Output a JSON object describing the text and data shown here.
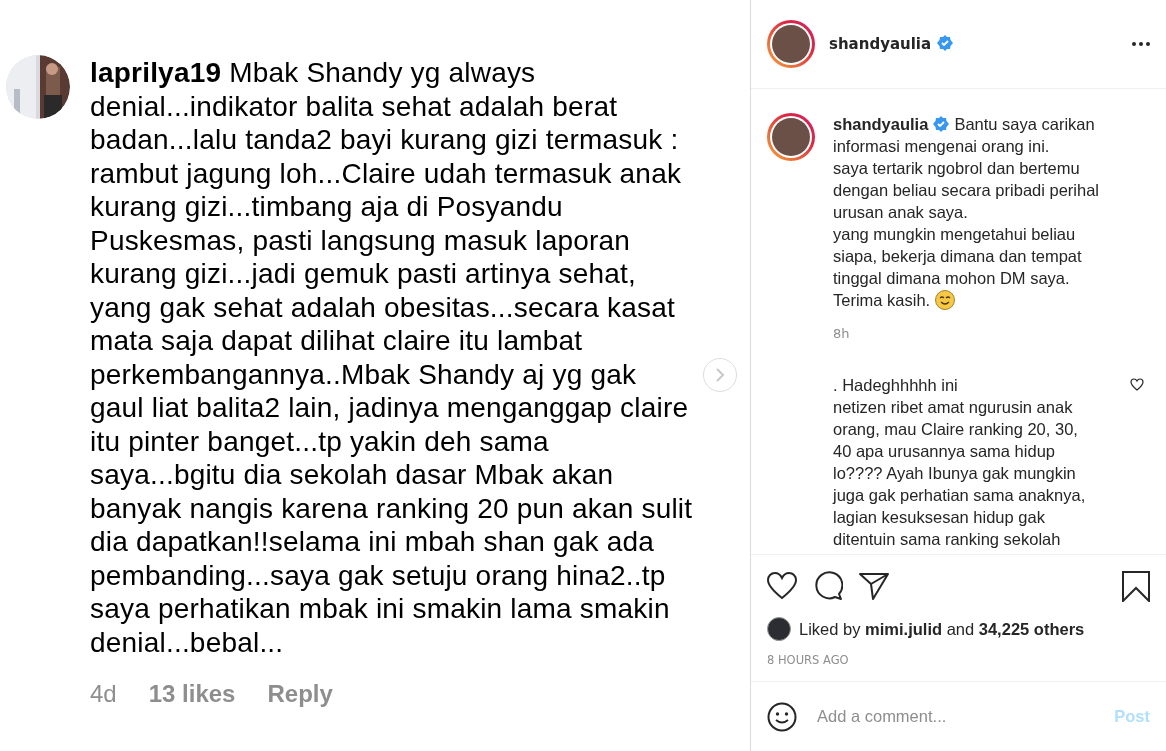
{
  "post_image": {
    "comment": {
      "lines": [
        "**laprilya19** Mbak Shandy yg always",
        "denial...indikator  balita sehat adalah berat",
        "badan...lalu tanda2 bayi kurang gizi termasuk :",
        "rambut jagung loh...Claire udah termasuk anak",
        "kurang gizi...timbang aja di Posyandu",
        "Puskesmas, pasti langsung masuk laporan",
        "kurang gizi...jadi gemuk pasti artinya sehat,",
        "yang gak sehat adalah obesitas...secara kasat",
        "mata saja dapat dilihat claire itu lambat",
        "perkembangannya..Mbak Shandy aj yg gak",
        "gaul liat balita2 lain, jadinya menganggap claire",
        "itu pinter banget...tp yakin deh sama",
        "saya...bgitu dia sekolah dasar Mbak akan",
        "banyak nangis karena ranking 20 pun akan sulit",
        "dia dapatkan!!selama ini mbah shan gak ada",
        "pembanding...saya gak setuju orang hina2..tp",
        "saya perhatikan mbak ini smakin lama smakin",
        "denial...bebal..."
      ],
      "time": "4d",
      "likes": "13 likes",
      "reply": "Reply"
    }
  },
  "header": {
    "username": "shandyaulia",
    "verified": true
  },
  "caption": {
    "username": "shandyaulia",
    "verified": true,
    "lines": [
      "Bantu saya carikan",
      "informasi mengenai orang ini.",
      "saya tertarik ngobrol dan bertemu",
      "dengan beliau secara pribadi perihal",
      "urusan anak saya.",
      "yang mungkin mengetahui beliau",
      "siapa, bekerja dimana dan tempat",
      "tinggal dimana mohon DM saya.",
      "Terima kasih."
    ],
    "time": "8h"
  },
  "comments": [
    {
      "lines": [
        ". Hadeghhhhh ini",
        "netizen ribet amat ngurusin anak",
        "orang, mau Claire ranking 20, 30,",
        "40 apa urusannya sama hidup",
        "lo???? Ayah Ibunya gak mungkin",
        "juga gak perhatian sama anaknya,",
        "lagian kesuksesan hidup gak",
        "ditentuin sama ranking sekolah"
      ],
      "liked": false
    }
  ],
  "actions": {
    "liked": false,
    "saved": false
  },
  "likes": {
    "text": "Liked by **mimi.julid** and **34,225 others**"
  },
  "timestamp": "8 HOURS AGO",
  "comment_box": {
    "placeholder": "Add a comment...",
    "button": "Post"
  }
}
